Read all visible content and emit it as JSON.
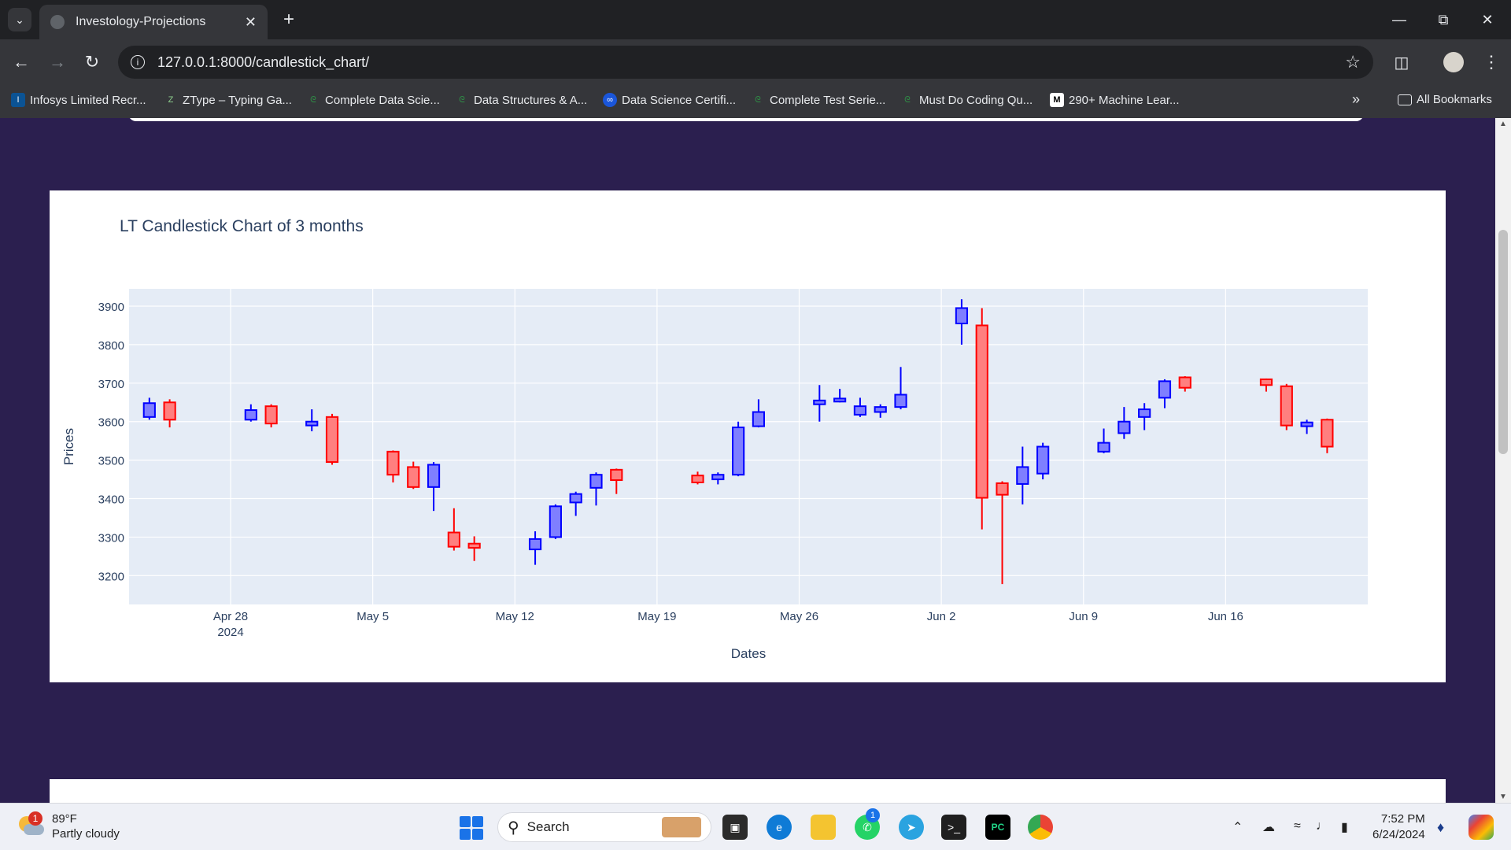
{
  "browser": {
    "tab_title": "Investology-Projections",
    "url": "127.0.0.1:8000/candlestick_chart/",
    "bookmarks": [
      {
        "label": "Infosys Limited Recr...",
        "icon": "infosys-icon"
      },
      {
        "label": "ZType – Typing Ga...",
        "icon": "ztype-icon"
      },
      {
        "label": "Complete Data Scie...",
        "icon": "gfg-icon"
      },
      {
        "label": "Data Structures & A...",
        "icon": "gfg-icon"
      },
      {
        "label": "Data Science Certifi...",
        "icon": "link-icon"
      },
      {
        "label": "Complete Test Serie...",
        "icon": "gfg-icon"
      },
      {
        "label": "Must Do Coding Qu...",
        "icon": "gfg-icon"
      },
      {
        "label": "290+ Machine Lear...",
        "icon": "medium-icon"
      }
    ],
    "more_bookmarks": "»",
    "all_bookmarks": "All Bookmarks"
  },
  "chart_data": {
    "type": "candlestick",
    "title": "LT Candlestick Chart of 3 months",
    "xlabel": "Dates",
    "ylabel": "Prices",
    "ylim": [
      3125,
      3945
    ],
    "xlim": [
      "2024-04-23",
      "2024-06-23"
    ],
    "xticks": [
      {
        "date": "2024-04-28",
        "label": "Apr 28",
        "sublabel": "2024"
      },
      {
        "date": "2024-05-05",
        "label": "May 5"
      },
      {
        "date": "2024-05-12",
        "label": "May 12"
      },
      {
        "date": "2024-05-19",
        "label": "May 19"
      },
      {
        "date": "2024-05-26",
        "label": "May 26"
      },
      {
        "date": "2024-06-02",
        "label": "Jun 2"
      },
      {
        "date": "2024-06-09",
        "label": "Jun 9"
      },
      {
        "date": "2024-06-16",
        "label": "Jun 16"
      }
    ],
    "yticks": [
      3200,
      3300,
      3400,
      3500,
      3600,
      3700,
      3800,
      3900
    ],
    "grid": true,
    "colors": {
      "increasing": "#0000ff",
      "decreasing": "#ff0000",
      "plot_bg": "#e5ecf6"
    },
    "candles": [
      {
        "date": "2024-04-24",
        "open": 3612,
        "high": 3662,
        "low": 3605,
        "close": 3648
      },
      {
        "date": "2024-04-25",
        "open": 3650,
        "high": 3658,
        "low": 3585,
        "close": 3605
      },
      {
        "date": "2024-04-29",
        "open": 3605,
        "high": 3645,
        "low": 3600,
        "close": 3630
      },
      {
        "date": "2024-04-30",
        "open": 3640,
        "high": 3645,
        "low": 3585,
        "close": 3595
      },
      {
        "date": "2024-05-02",
        "open": 3590,
        "high": 3632,
        "low": 3575,
        "close": 3600
      },
      {
        "date": "2024-05-03",
        "open": 3612,
        "high": 3620,
        "low": 3488,
        "close": 3495
      },
      {
        "date": "2024-05-06",
        "open": 3522,
        "high": 3525,
        "low": 3442,
        "close": 3462
      },
      {
        "date": "2024-05-07",
        "open": 3482,
        "high": 3496,
        "low": 3425,
        "close": 3430
      },
      {
        "date": "2024-05-08",
        "open": 3430,
        "high": 3495,
        "low": 3368,
        "close": 3488
      },
      {
        "date": "2024-05-09",
        "open": 3312,
        "high": 3375,
        "low": 3265,
        "close": 3275
      },
      {
        "date": "2024-05-10",
        "open": 3283,
        "high": 3302,
        "low": 3238,
        "close": 3272
      },
      {
        "date": "2024-05-13",
        "open": 3268,
        "high": 3315,
        "low": 3228,
        "close": 3295
      },
      {
        "date": "2024-05-14",
        "open": 3300,
        "high": 3385,
        "low": 3295,
        "close": 3380
      },
      {
        "date": "2024-05-15",
        "open": 3390,
        "high": 3418,
        "low": 3355,
        "close": 3412
      },
      {
        "date": "2024-05-16",
        "open": 3428,
        "high": 3468,
        "low": 3382,
        "close": 3462
      },
      {
        "date": "2024-05-17",
        "open": 3475,
        "high": 3478,
        "low": 3412,
        "close": 3448
      },
      {
        "date": "2024-05-21",
        "open": 3460,
        "high": 3470,
        "low": 3437,
        "close": 3442
      },
      {
        "date": "2024-05-22",
        "open": 3450,
        "high": 3468,
        "low": 3437,
        "close": 3462
      },
      {
        "date": "2024-05-23",
        "open": 3462,
        "high": 3600,
        "low": 3458,
        "close": 3585
      },
      {
        "date": "2024-05-24",
        "open": 3588,
        "high": 3658,
        "low": 3585,
        "close": 3625
      },
      {
        "date": "2024-05-27",
        "open": 3645,
        "high": 3695,
        "low": 3600,
        "close": 3655
      },
      {
        "date": "2024-05-28",
        "open": 3652,
        "high": 3685,
        "low": 3650,
        "close": 3660
      },
      {
        "date": "2024-05-29",
        "open": 3618,
        "high": 3662,
        "low": 3612,
        "close": 3640
      },
      {
        "date": "2024-05-30",
        "open": 3625,
        "high": 3645,
        "low": 3610,
        "close": 3638
      },
      {
        "date": "2024-05-31",
        "open": 3638,
        "high": 3742,
        "low": 3632,
        "close": 3670
      },
      {
        "date": "2024-06-03",
        "open": 3855,
        "high": 3918,
        "low": 3800,
        "close": 3895
      },
      {
        "date": "2024-06-04",
        "open": 3850,
        "high": 3895,
        "low": 3320,
        "close": 3402
      },
      {
        "date": "2024-06-05",
        "open": 3440,
        "high": 3445,
        "low": 3178,
        "close": 3410
      },
      {
        "date": "2024-06-06",
        "open": 3438,
        "high": 3535,
        "low": 3385,
        "close": 3482
      },
      {
        "date": "2024-06-07",
        "open": 3465,
        "high": 3545,
        "low": 3450,
        "close": 3535
      },
      {
        "date": "2024-06-10",
        "open": 3522,
        "high": 3582,
        "low": 3518,
        "close": 3545
      },
      {
        "date": "2024-06-11",
        "open": 3570,
        "high": 3638,
        "low": 3555,
        "close": 3600
      },
      {
        "date": "2024-06-12",
        "open": 3612,
        "high": 3648,
        "low": 3578,
        "close": 3632
      },
      {
        "date": "2024-06-13",
        "open": 3662,
        "high": 3710,
        "low": 3635,
        "close": 3705
      },
      {
        "date": "2024-06-14",
        "open": 3715,
        "high": 3718,
        "low": 3678,
        "close": 3688
      },
      {
        "date": "2024-06-18",
        "open": 3710,
        "high": 3712,
        "low": 3678,
        "close": 3695
      },
      {
        "date": "2024-06-19",
        "open": 3692,
        "high": 3698,
        "low": 3578,
        "close": 3590
      },
      {
        "date": "2024-06-20",
        "open": 3588,
        "high": 3605,
        "low": 3568,
        "close": 3598
      },
      {
        "date": "2024-06-21",
        "open": 3605,
        "high": 3608,
        "low": 3518,
        "close": 3535
      }
    ]
  },
  "taskbar": {
    "temperature": "89°F",
    "weather": "Partly cloudy",
    "weather_badge": "1",
    "search_placeholder": "Search",
    "whatsapp_badge": "1",
    "time": "7:52 PM",
    "date": "6/24/2024"
  }
}
